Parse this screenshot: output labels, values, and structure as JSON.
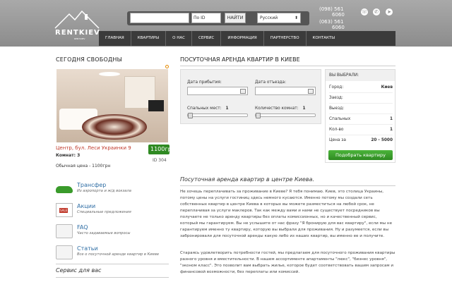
{
  "brand": {
    "logo_text": "RENTKIEV",
    "logo_sub": "RENT.KIEV"
  },
  "search": {
    "placeholder": "",
    "select_label": "По ID",
    "button_label": "НАЙТИ",
    "lang": "Русский"
  },
  "phones": [
    {
      "code": "(098) 561",
      "num": "6060"
    },
    {
      "code": "(063) 561",
      "num": "6060"
    }
  ],
  "social": [
    "viber-icon",
    "whatsapp-icon",
    "telegram-icon"
  ],
  "nav": [
    "Главная",
    "Квартиры",
    "О нас",
    "Сервис",
    "Информация",
    "Партнерство",
    "Контакты"
  ],
  "left": {
    "free_today_title": "Сегодня свободны",
    "apt": {
      "address": "Центр, бул. Леси Украинки 9",
      "rooms": "Комнат: 3",
      "price_badge": "1100гр",
      "id_text": "ID 304",
      "normal_price": "Обычная цена - 1100грн"
    },
    "links": [
      {
        "title": "Трансфер",
        "desc": "Из аэропорта и ж/д вокзала",
        "icon": "car-icon"
      },
      {
        "title": "Акции",
        "desc": "Специальные предложения",
        "icon": "sale-icon"
      },
      {
        "title": "FAQ",
        "desc": "Часто задаваемые вопросы",
        "icon": "faq-icon"
      },
      {
        "title": "Статьи",
        "desc": "Все о посуточной аренде квартир в Киеве",
        "icon": "articles-icon"
      }
    ],
    "service_title": "Сервис для вас"
  },
  "main": {
    "title": "Посуточная аренда квартир в Киеве",
    "arrival_label": "Дата прибытия:",
    "departure_label": "Дата отъезда:",
    "beds_label": "Спальных мест:",
    "beds_value": "1",
    "rooms_label": "Количество комнат:",
    "rooms_value": "1",
    "beds_level": 0,
    "rooms_level": 0
  },
  "summary": {
    "title": "Вы выбрали:",
    "rows": [
      {
        "k": "Город:",
        "v": "Киев"
      },
      {
        "k": "Заезд:",
        "v": ""
      },
      {
        "k": "Выезд:",
        "v": ""
      },
      {
        "k": "Спальных",
        "v": "1"
      },
      {
        "k": "Кол-во",
        "v": "1"
      },
      {
        "k": "Цена за",
        "v": "20 - 5000"
      }
    ],
    "button": "Подобрать квартиру"
  },
  "article": {
    "title": "Посуточная аренда квартир в центре Киева.",
    "p1": "Не хочешь переплачивать за проживание в Киеве? Я тебя понимаю. Киев, это столица Украины, потому цены на услуги гостиниц здесь немного кусаются. Именно потому мы создали сеть собственных квартир в центре Киева в которых вы можете разместиться на любой срок, не переплачивая за услуги маклеров. Так как между вами и нами не существует посредников вы получаете не только аренду квартиры без оплаты комиссионных, но и качественный сервис, который мы гарантируем. Вы не услышите от нас фразу \"Я бронирую для вас квартиру\", если мы не гарантируем именно ту квартиру, которую вы выбрали для проживания. Ну и разумеется, если вы забронировали для посуточной аренды какую либо из наших квартир, вы именно ее и получите.",
    "p2": "Стараясь удовлетворить потребности гостей, мы предлагаем для посуточного проживания квартиры разного уровня и вместительности. В нашем ассортименте апартаменты \"люкс\", \"бизнес уровня\", \"эконом класс\". Это позволит вам выбрать жилье, которое будет соответствовать вашим запросам и финансовой возможности, без переплаты или комиссий."
  }
}
